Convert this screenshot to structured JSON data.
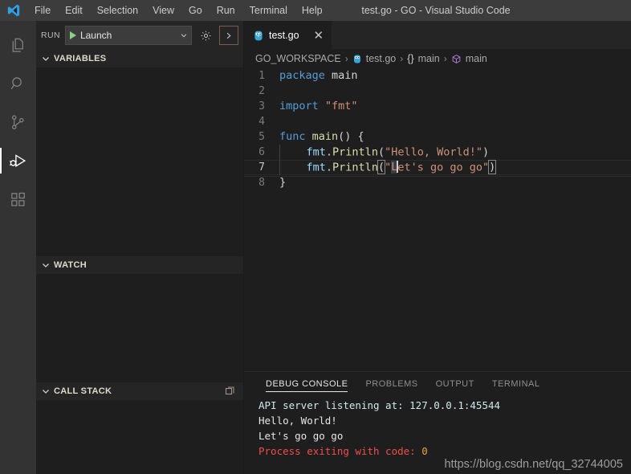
{
  "window": {
    "title": "test.go - GO - Visual Studio Code",
    "logo_icon": "vscode-logo-icon"
  },
  "menubar": {
    "items": [
      {
        "label": "File"
      },
      {
        "label": "Edit"
      },
      {
        "label": "Selection"
      },
      {
        "label": "View"
      },
      {
        "label": "Go"
      },
      {
        "label": "Run"
      },
      {
        "label": "Terminal"
      },
      {
        "label": "Help"
      }
    ]
  },
  "activitybar": {
    "items": [
      {
        "name": "explorer-icon",
        "active": false
      },
      {
        "name": "search-icon",
        "active": false
      },
      {
        "name": "source-control-icon",
        "active": false
      },
      {
        "name": "run-and-debug-icon",
        "active": true
      },
      {
        "name": "extensions-icon",
        "active": false
      }
    ]
  },
  "sidebar": {
    "run_toolbar": {
      "run_label": "RUN",
      "play_icon": "play-icon",
      "configuration": "Launch",
      "dropdown_icon": "chevron-down-icon",
      "gear_icon": "gear-icon",
      "console_icon": "open-debug-console-icon"
    },
    "sections": [
      {
        "title": "VARIABLES",
        "twist_icon": "chevron-down-icon",
        "action_icon": ""
      },
      {
        "title": "WATCH",
        "twist_icon": "chevron-down-icon",
        "action_icon": ""
      },
      {
        "title": "CALL STACK",
        "twist_icon": "chevron-down-icon",
        "action_icon": "multi-window-icon"
      }
    ]
  },
  "editor": {
    "tab": {
      "file_icon": "go-gopher-icon",
      "label": "test.go",
      "close_icon": "close-icon"
    },
    "breadcrumb": [
      {
        "label": "GO_WORKSPACE",
        "icon": ""
      },
      {
        "label": "test.go",
        "icon": "go-gopher-icon"
      },
      {
        "label": "main",
        "icon": "braces-icon"
      },
      {
        "label": "main",
        "icon": "symbol-method-icon"
      }
    ],
    "breadcrumb_separator": "›",
    "lines": [
      {
        "number": "1",
        "text": "package main"
      },
      {
        "number": "2",
        "text": ""
      },
      {
        "number": "3",
        "text": "import \"fmt\""
      },
      {
        "number": "4",
        "text": ""
      },
      {
        "number": "5",
        "text": "func main() {"
      },
      {
        "number": "6",
        "text": "    fmt.Println(\"Hello, World!\")"
      },
      {
        "number": "7",
        "text": "    fmt.Println(\"Let's go go go\")"
      },
      {
        "number": "8",
        "text": "}"
      }
    ],
    "active_line": "7"
  },
  "panel": {
    "tabs": [
      {
        "label": "DEBUG CONSOLE",
        "active": true
      },
      {
        "label": "PROBLEMS",
        "active": false
      },
      {
        "label": "OUTPUT",
        "active": false
      },
      {
        "label": "TERMINAL",
        "active": false
      }
    ],
    "console_lines": [
      {
        "text": "API server listening at: 127.0.0.1:45544",
        "style": "info"
      },
      {
        "text": "Hello, World!",
        "style": "out"
      },
      {
        "text": "Let's go go go",
        "style": "out"
      },
      {
        "text": "Process exiting with code: ",
        "style": "err",
        "suffix": "0"
      }
    ]
  },
  "watermark": {
    "text": "https://blog.csdn.net/qq_32744005"
  },
  "colors": {
    "accent_blue": "#0098ff",
    "keyword": "#569cd6",
    "string": "#ce9178",
    "function": "#dcdcaa",
    "identifier": "#9cdcfe",
    "error": "#f14c4c",
    "number": "#e8a23d",
    "titlebar_bg": "#3c3c3c",
    "sidebar_bg": "#252526",
    "editor_bg": "#1e1e1e"
  }
}
